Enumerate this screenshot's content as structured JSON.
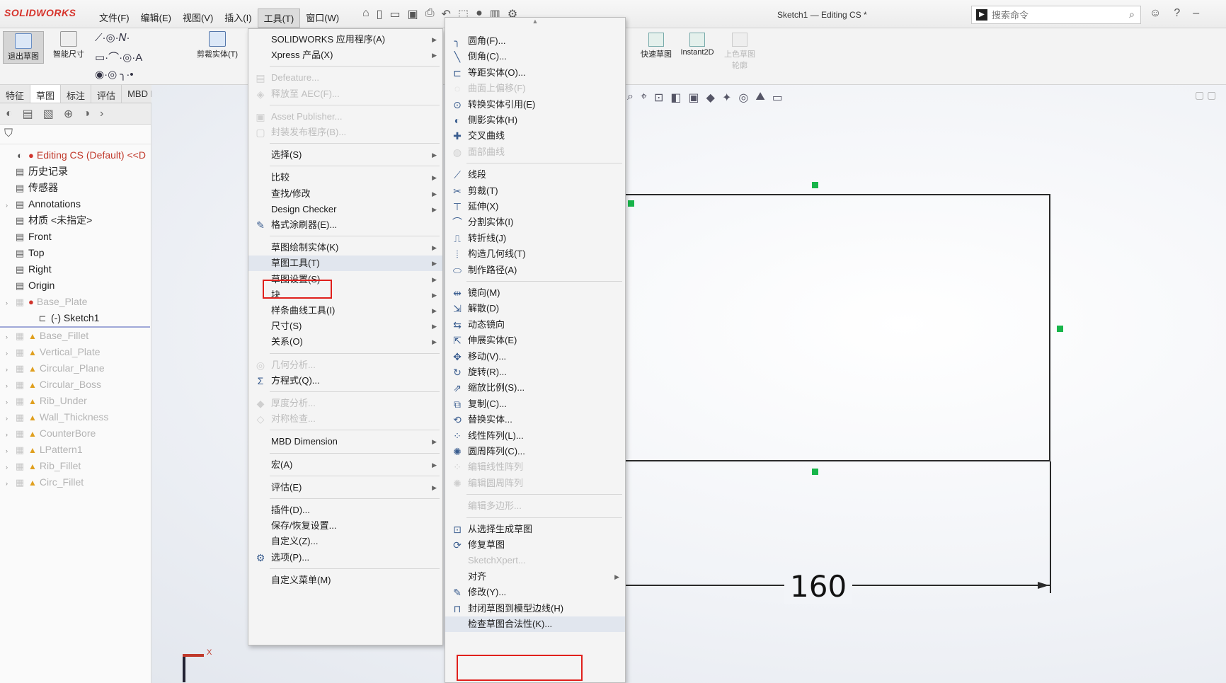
{
  "app": {
    "logo": "SOLIDWORKS",
    "doc_title": "Sketch1 — Editing CS *"
  },
  "menubar": [
    "文件(F)",
    "编辑(E)",
    "视图(V)",
    "插入(I)",
    "工具(T)",
    "窗口(W)"
  ],
  "search": {
    "placeholder": "搜索命令"
  },
  "ribbon": {
    "exit_sketch": "退出草图",
    "smart_dim": "智能尺寸",
    "trim": "剪裁实体(T)",
    "quick_snaps": "快速草图",
    "instant2d": "Instant2D",
    "shaded_contours": "上色草图轮廓"
  },
  "cmd_tabs": [
    "特征",
    "草图",
    "标注",
    "评估",
    "MBD Dimensions"
  ],
  "tree": [
    {
      "label": "Editing CS  (Default) <<D",
      "kind": "root"
    },
    {
      "label": "历史记录",
      "kind": "normal"
    },
    {
      "label": "传感器",
      "kind": "normal"
    },
    {
      "label": "Annotations",
      "kind": "normal"
    },
    {
      "label": "材质 <未指定>",
      "kind": "normal"
    },
    {
      "label": "Front",
      "kind": "normal"
    },
    {
      "label": "Top",
      "kind": "normal"
    },
    {
      "label": "Right",
      "kind": "normal"
    },
    {
      "label": "Origin",
      "kind": "normal"
    },
    {
      "label": "Base_Plate",
      "kind": "grey-err"
    },
    {
      "label": "(-) Sketch1",
      "kind": "sketch"
    },
    {
      "label": "Base_Fillet",
      "kind": "grey"
    },
    {
      "label": "Vertical_Plate",
      "kind": "grey"
    },
    {
      "label": "Circular_Plane",
      "kind": "grey"
    },
    {
      "label": "Circular_Boss",
      "kind": "grey"
    },
    {
      "label": "Rib_Under",
      "kind": "grey"
    },
    {
      "label": "Wall_Thickness",
      "kind": "grey"
    },
    {
      "label": "CounterBore",
      "kind": "grey"
    },
    {
      "label": "LPattern1",
      "kind": "grey"
    },
    {
      "label": "Rib_Fillet",
      "kind": "grey"
    },
    {
      "label": "Circ_Fillet",
      "kind": "grey"
    }
  ],
  "tools_menu": [
    {
      "label": "SOLIDWORKS 应用程序(A)",
      "sub": true
    },
    {
      "label": "Xpress 产品(X)",
      "sub": true
    },
    {
      "sep": true
    },
    {
      "label": "Defeature...",
      "dis": true,
      "icon": "▤"
    },
    {
      "label": "释放至 AEC(F)...",
      "dis": true,
      "icon": "◈"
    },
    {
      "sep": true
    },
    {
      "label": "Asset Publisher...",
      "dis": true,
      "icon": "▣"
    },
    {
      "label": "封装发布程序(B)...",
      "dis": true,
      "icon": "▢"
    },
    {
      "sep": true
    },
    {
      "label": "选择(S)",
      "sub": true
    },
    {
      "sep": true
    },
    {
      "label": "比较",
      "sub": true
    },
    {
      "label": "查找/修改",
      "sub": true
    },
    {
      "label": "Design Checker",
      "sub": true
    },
    {
      "label": "格式涂刷器(E)...",
      "icon": "✎"
    },
    {
      "sep": true
    },
    {
      "label": "草图绘制实体(K)",
      "sub": true
    },
    {
      "label": "草图工具(T)",
      "sub": true,
      "hl": true
    },
    {
      "label": "草图设置(S)",
      "sub": true
    },
    {
      "label": "块",
      "sub": true
    },
    {
      "label": "样条曲线工具(I)",
      "sub": true
    },
    {
      "label": "尺寸(S)",
      "sub": true
    },
    {
      "label": "关系(O)",
      "sub": true
    },
    {
      "sep": true
    },
    {
      "label": "几何分析...",
      "dis": true,
      "icon": "◎"
    },
    {
      "label": "方程式(Q)...",
      "icon": "Σ"
    },
    {
      "sep": true
    },
    {
      "label": "厚度分析...",
      "dis": true,
      "icon": "◆"
    },
    {
      "label": "对称检查...",
      "dis": true,
      "icon": "◇"
    },
    {
      "sep": true
    },
    {
      "label": "MBD Dimension",
      "sub": true
    },
    {
      "sep": true
    },
    {
      "label": "宏(A)",
      "sub": true
    },
    {
      "sep": true
    },
    {
      "label": "评估(E)",
      "sub": true
    },
    {
      "sep": true
    },
    {
      "label": "插件(D)..."
    },
    {
      "label": "保存/恢复设置..."
    },
    {
      "label": "自定义(Z)..."
    },
    {
      "label": "选项(P)...",
      "icon": "⚙"
    },
    {
      "sep": true
    },
    {
      "label": "自定义菜单(M)"
    }
  ],
  "sketch_tools_menu": [
    {
      "label": "圆角(F)...",
      "icon": "╮"
    },
    {
      "label": "倒角(C)...",
      "icon": "╲"
    },
    {
      "label": "等距实体(O)...",
      "icon": "⊏"
    },
    {
      "label": "曲面上偏移(F)",
      "dis": true,
      "icon": "◌"
    },
    {
      "label": "转换实体引用(E)",
      "icon": "⊙"
    },
    {
      "label": "侧影实体(H)",
      "icon": "◐"
    },
    {
      "label": "交叉曲线",
      "icon": "✚"
    },
    {
      "label": "面部曲线",
      "dis": true,
      "icon": "◍"
    },
    {
      "sep": true
    },
    {
      "label": "线段",
      "icon": "⟋"
    },
    {
      "label": "剪裁(T)",
      "icon": "✂"
    },
    {
      "label": "延伸(X)",
      "icon": "⊤"
    },
    {
      "label": "分割实体(I)",
      "icon": "⌒"
    },
    {
      "label": "转折线(J)",
      "icon": "⎍"
    },
    {
      "label": "构造几何线(T)",
      "icon": "⦙"
    },
    {
      "label": "制作路径(A)",
      "icon": "⬭"
    },
    {
      "sep": true
    },
    {
      "label": "镜向(M)",
      "icon": "⇹"
    },
    {
      "label": "解散(D)",
      "icon": "⇲"
    },
    {
      "label": "动态镜向",
      "icon": "⇆"
    },
    {
      "label": "伸展实体(E)",
      "icon": "⇱"
    },
    {
      "label": "移动(V)...",
      "icon": "✥"
    },
    {
      "label": "旋转(R)...",
      "icon": "↻"
    },
    {
      "label": "缩放比例(S)...",
      "icon": "⇗"
    },
    {
      "label": "复制(C)...",
      "icon": "⧉"
    },
    {
      "label": "替换实体...",
      "icon": "⟲"
    },
    {
      "label": "线性阵列(L)...",
      "icon": "⁘"
    },
    {
      "label": "圆周阵列(C)...",
      "icon": "✺"
    },
    {
      "label": "编辑线性阵列",
      "dis": true,
      "icon": "⁘"
    },
    {
      "label": "编辑圆周阵列",
      "dis": true,
      "icon": "✺"
    },
    {
      "sep": true
    },
    {
      "label": "编辑多边形...",
      "dis": true
    },
    {
      "sep": true
    },
    {
      "label": "从选择生成草图",
      "icon": "⊡"
    },
    {
      "label": "修复草图",
      "icon": "⟳"
    },
    {
      "label": "SketchXpert...",
      "dis": true
    },
    {
      "label": "对齐",
      "sub": true
    },
    {
      "label": "修改(Y)...",
      "icon": "✎"
    },
    {
      "label": "封闭草图到模型边线(H)",
      "icon": "⊓"
    },
    {
      "label": "检查草图合法性(K)...",
      "hl": true
    }
  ],
  "dimension": {
    "value": "160"
  },
  "triad": {
    "x_label": "X"
  },
  "colors": {
    "accent": "#e0201c",
    "handle": "#18b54a",
    "logo": "#d6332b"
  }
}
